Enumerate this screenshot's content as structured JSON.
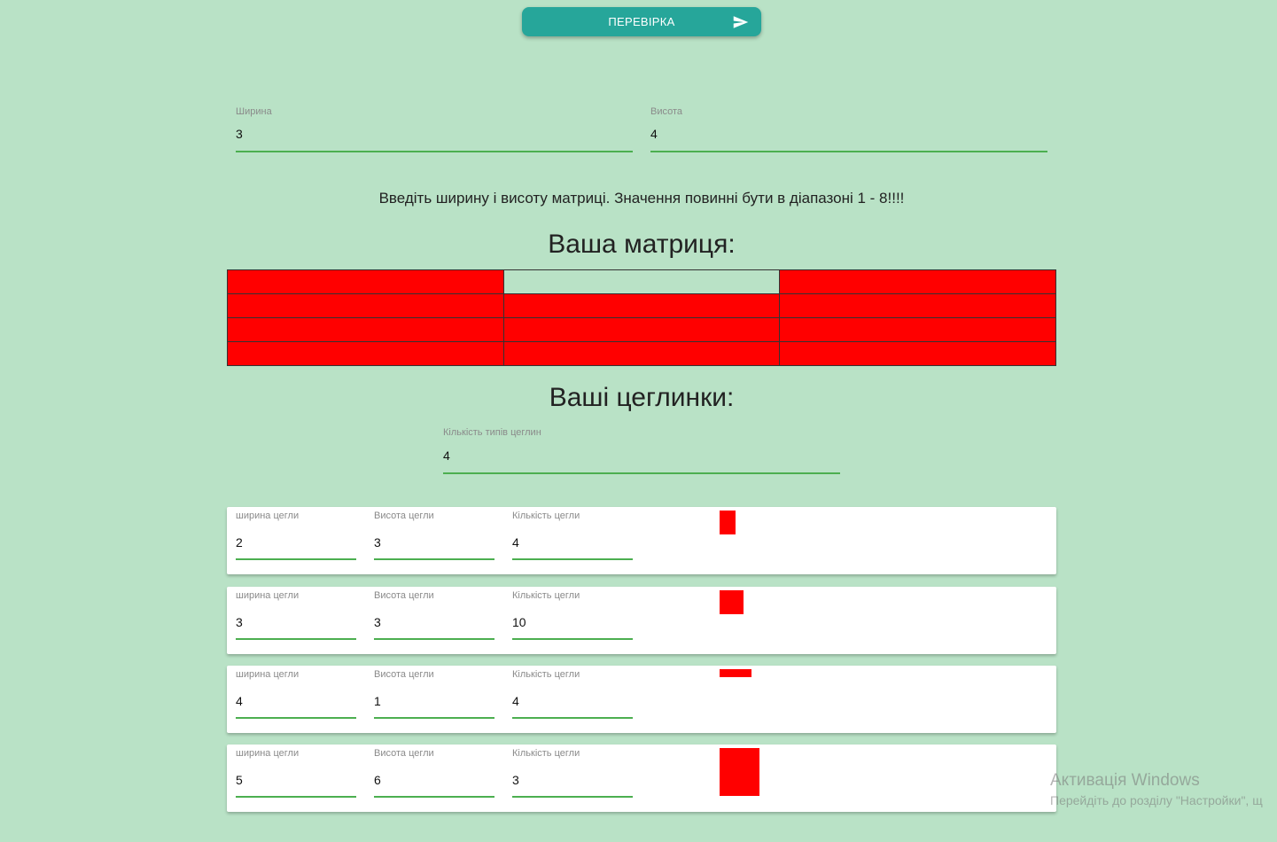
{
  "check_button": {
    "label": "ПЕРЕВІРКА",
    "icon": "send-icon"
  },
  "dimensions": {
    "width_label": "Ширина",
    "width_value": "3",
    "height_label": "Висота",
    "height_value": "4"
  },
  "note": "Введіть ширину і висоту матриці. Значення повинні бути в діапазоні 1 - 8!!!!",
  "matrix": {
    "heading": "Ваша матриця:",
    "colors": {
      "filled": "#ff0000",
      "empty": "#b9e2c6"
    },
    "rows": [
      [
        1,
        0,
        1
      ],
      [
        1,
        1,
        1
      ],
      [
        1,
        1,
        1
      ],
      [
        1,
        1,
        1
      ]
    ]
  },
  "bricks": {
    "heading": "Ваші цеглинки:",
    "types_label": "Кількість типів цеглин",
    "types_value": "4",
    "color": "#ff0000",
    "items": [
      {
        "width_label": "ширина цегли",
        "width": "2",
        "height_label": "Висота цегли",
        "height": "3",
        "count_label": "Кількість цегли",
        "count": "4"
      },
      {
        "width_label": "ширина цегли",
        "width": "3",
        "height_label": "Висота цегли",
        "height": "3",
        "count_label": "Кількість цегли",
        "count": "10"
      },
      {
        "width_label": "ширина цегли",
        "width": "4",
        "height_label": "Висота цегли",
        "height": "1",
        "count_label": "Кількість цегли",
        "count": "4"
      },
      {
        "width_label": "ширина цегли",
        "width": "5",
        "height_label": "Висота цегли",
        "height": "6",
        "count_label": "Кількість цегли",
        "count": "3"
      }
    ]
  },
  "watermark": {
    "title": "Активація Windows",
    "subtitle": "Перейдіть до розділу \"Настройки\", щ"
  }
}
